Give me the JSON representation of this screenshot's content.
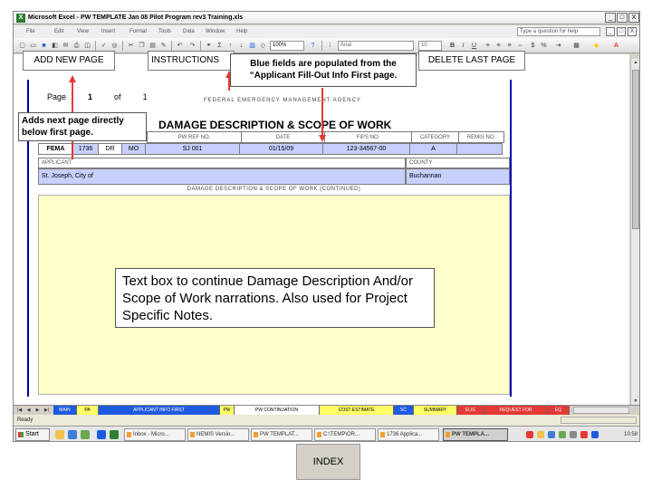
{
  "window": {
    "app_icon": "X",
    "title": "Microsoft Excel - PW TEMPLATE Jan 08 Pilot Program rev3 Training.xls",
    "min": "_",
    "restore": "□",
    "close": "X"
  },
  "menu": {
    "items": [
      "File",
      "Edit",
      "View",
      "Insert",
      "Format",
      "Tools",
      "Data",
      "Window",
      "Help"
    ],
    "ask_placeholder": "Type a question for help"
  },
  "toolbar": {
    "zoom": "100%",
    "font": "Arial",
    "size": "10",
    "icons": [
      "new-icon",
      "open-icon",
      "save-icon",
      "permission-icon",
      "email-icon",
      "print-icon",
      "print-preview-icon",
      "spelling-icon",
      "research-icon",
      "cut-icon",
      "copy-icon",
      "paste-icon",
      "format-painter-icon",
      "undo-icon",
      "redo-icon",
      "hyperlink-icon",
      "autosum-icon",
      "sort-asc-icon",
      "sort-desc-icon",
      "chart-icon",
      "drawing-icon",
      "help-icon",
      "bold-icon",
      "italic-icon",
      "underline-icon",
      "align-left-icon",
      "align-center-icon",
      "align-right-icon",
      "merge-icon",
      "currency-icon",
      "percent-icon",
      "borders-icon",
      "fill-color-icon",
      "font-color-icon"
    ]
  },
  "sheet_buttons": {
    "add_new_page": "ADD NEW PAGE",
    "instructions": "INSTRUCTIONS",
    "delete_last_page": "DELETE LAST PAGE"
  },
  "form": {
    "page_label": "Page",
    "page_num": "1",
    "of_label": "of",
    "page_total": "1",
    "agency": "FEDERAL EMERGENCY MANAGEMENT AGENCY",
    "title": "DAMAGE DESCRIPTION & SCOPE OF WORK",
    "labels": [
      "PW REF NO.",
      "DATE",
      "FIPS NO.",
      "CATEGORY",
      "REMIS NO."
    ],
    "fema": "FEMA",
    "fema_no": "1736",
    "dr": "DR",
    "state": "MO",
    "pw_ref": "SJ 001",
    "date": "01/15/09",
    "fips": "123-34567-00",
    "category": "A",
    "remis": "",
    "applicant_label": "APPLICANT",
    "county_label": "COUNTY",
    "applicant": "St. Joseph, City of",
    "county": "Buchannan",
    "continued": "DAMAGE DESCRIPTION & SCOPE OF WORK (CONTINUED)"
  },
  "callouts": {
    "blue_fields": "Blue fields are populated from the “Applicant Fill-Out Info First page.",
    "adds_next": "Adds next page directly below first page.",
    "text_box": "Text box to continue Damage Description And/or Scope of Work narrations. Also used for Project Specific Notes."
  },
  "tabs": [
    {
      "label": "MAIN",
      "color": "#1e5be0"
    },
    {
      "label": "PA",
      "color": "#ffff66"
    },
    {
      "label": "APPLICANT INFO FIRST",
      "color": "#1e5be0"
    },
    {
      "label": "PW",
      "color": "#ffff66"
    },
    {
      "label": "PW CONTINUATION",
      "color": "#ffffff"
    },
    {
      "label": "COST ESTIMATE",
      "color": "#ffff66"
    },
    {
      "label": "SC",
      "color": "#1e5be0"
    },
    {
      "label": "SUMMARY",
      "color": "#ffff66"
    },
    {
      "label": "ELIG",
      "color": "#e53935"
    },
    {
      "label": "REQUEST FOR",
      "color": "#e53935"
    },
    {
      "label": "EQ",
      "color": "#e53935"
    }
  ],
  "status": {
    "text": "Ready"
  },
  "taskbar": {
    "start": "Start",
    "buttons": [
      "Inbox - Micro...",
      "NEMIS Versio...",
      "PW TEMPLAT...",
      "C:\\TEMP\\OR...",
      "1736 Applica...",
      "PW TEMPLA..."
    ],
    "active_index": 5,
    "clock": "10:58"
  },
  "index_button": "INDEX"
}
